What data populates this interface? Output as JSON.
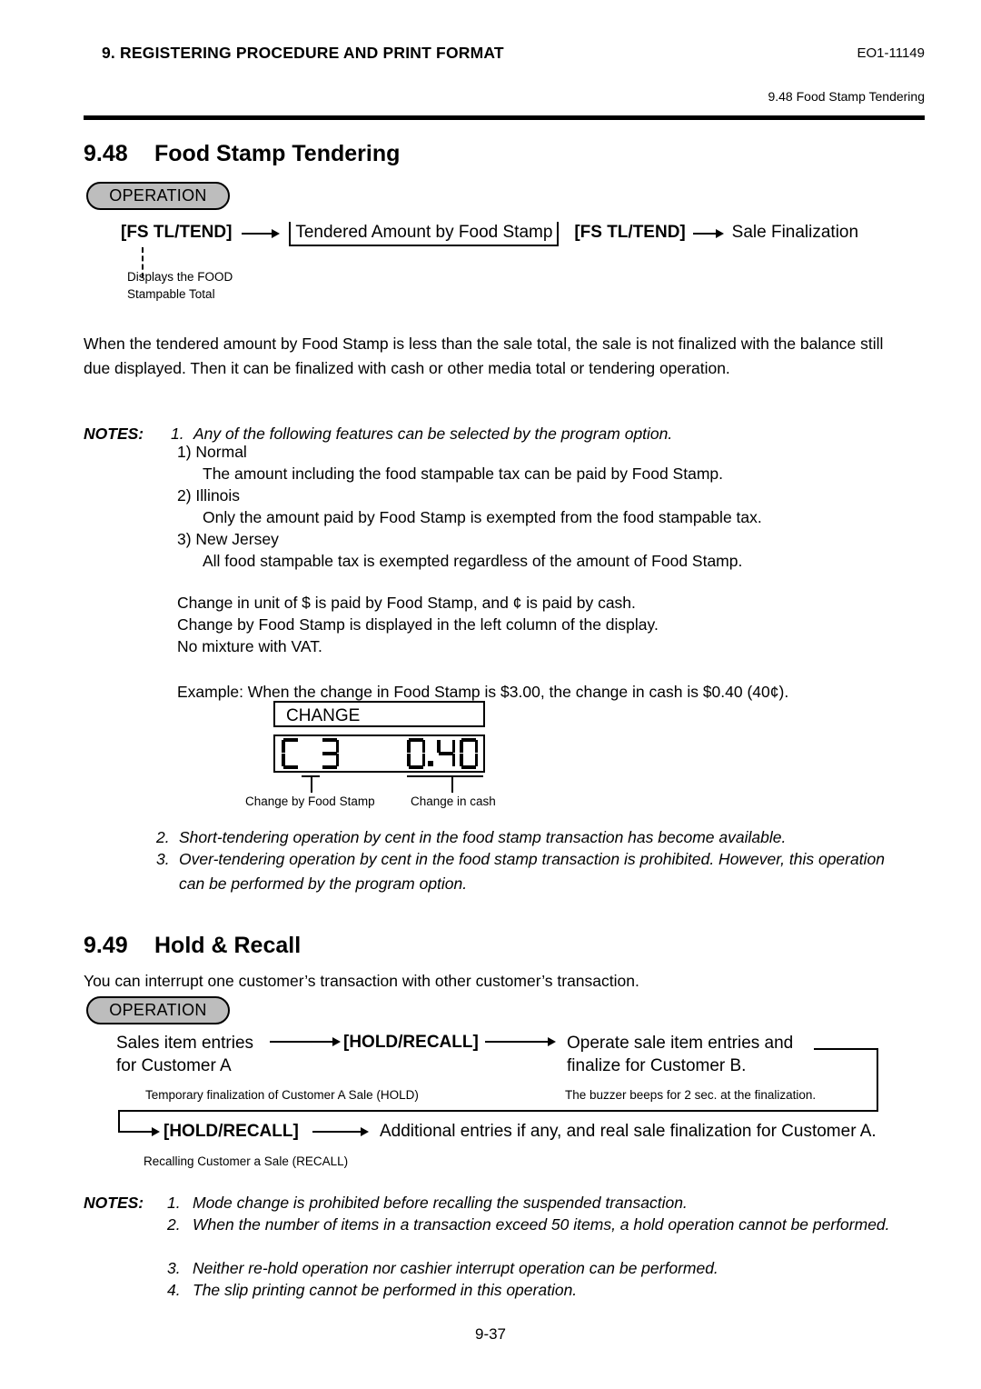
{
  "header": {
    "chapter_title": "9. REGISTERING PROCEDURE AND PRINT FORMAT",
    "doc_code": "EO1-11149",
    "running_head": "9.48 Food Stamp Tendering"
  },
  "section_948": {
    "number": "9.48",
    "title": "Food Stamp Tendering",
    "operation_badge": "OPERATION",
    "flow": {
      "key1": "[FS TL/TEND]",
      "field": "Tendered Amount by Food Stamp",
      "key2": "[FS TL/TEND]",
      "result": "Sale Finalization",
      "callout_line1": "Displays the FOOD",
      "callout_line2": "Stampable Total"
    },
    "intro_paragraph": "When the tendered amount by Food Stamp is less than the sale total, the sale is not finalized with the balance still due displayed.  Then it can be finalized with cash or other media total or tendering operation.",
    "notes_label": "NOTES:",
    "note1_number": "1.",
    "note1_text": "Any of the following features can be selected by the program option.",
    "options": [
      {
        "label": "1) Normal",
        "desc": "The amount including the food stampable tax can be paid by Food Stamp."
      },
      {
        "label": "2) Illinois",
        "desc": "Only the amount paid by Food Stamp is exempted from the food stampable tax."
      },
      {
        "label": "3) New Jersey",
        "desc": "All food stampable tax is exempted regardless of the amount of Food Stamp."
      }
    ],
    "change_rules": [
      "Change in unit of $ is paid by Food Stamp, and ¢ is paid by cash.",
      "Change by Food Stamp is displayed in the left column of the display.",
      "No mixture with VAT."
    ],
    "example_text": "Example: When the change in Food Stamp is $3.00, the change in cash is $0.40 (40¢).",
    "display": {
      "top_label": "CHANGE",
      "left_value": "C 3",
      "right_value": "0.40",
      "left_caption": "Change by Food Stamp",
      "right_caption": "Change in cash"
    },
    "note2_number": "2.",
    "note2_text": "Short-tendering operation by cent in the food stamp transaction has become available.",
    "note3_number": "3.",
    "note3_text": "Over-tendering operation by cent in the food stamp transaction is prohibited.  However, this operation can be performed by the program option."
  },
  "section_949": {
    "number": "9.49",
    "title": "Hold & Recall",
    "intro_paragraph": "You can interrupt one customer’s transaction with other customer’s transaction.",
    "operation_badge": "OPERATION",
    "flow": {
      "step1_line1": "Sales item entries",
      "step1_line2": "for Customer A",
      "key1": "[HOLD/RECALL]",
      "step2_line1": "Operate sale item entries and",
      "step2_line2": "finalize for Customer B.",
      "caption1": "Temporary finalization of Customer A Sale (HOLD)",
      "caption2": "The buzzer beeps for 2 sec. at the finalization.",
      "key2": "[HOLD/RECALL]",
      "step3": "Additional entries if any, and real sale finalization for Customer A.",
      "caption3": "Recalling Customer a Sale (RECALL)"
    },
    "notes_label": "NOTES:",
    "notes": [
      {
        "number": "1.",
        "text": "Mode change is prohibited before recalling the suspended transaction."
      },
      {
        "number": "2.",
        "text": "When the number of items in a transaction exceed 50 items, a hold operation cannot be performed."
      },
      {
        "number": "3.",
        "text": "Neither re-hold operation nor cashier interrupt operation can be performed."
      },
      {
        "number": "4.",
        "text": "The slip printing cannot be performed in this operation."
      }
    ]
  },
  "footer": {
    "page_number": "9-37"
  }
}
